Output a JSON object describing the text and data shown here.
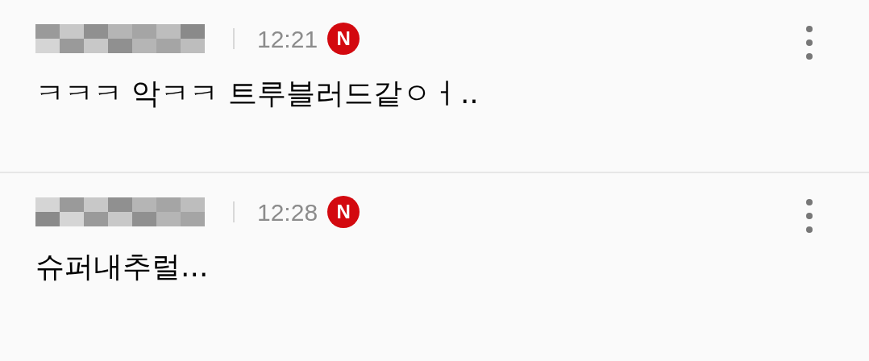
{
  "comments": [
    {
      "time": "12:21",
      "badge": "N",
      "text": "ㅋㅋㅋ 악ㅋㅋ 트루블러드같ㅇㅓ.."
    },
    {
      "time": "12:28",
      "badge": "N",
      "text": "슈퍼내추럴..."
    }
  ]
}
